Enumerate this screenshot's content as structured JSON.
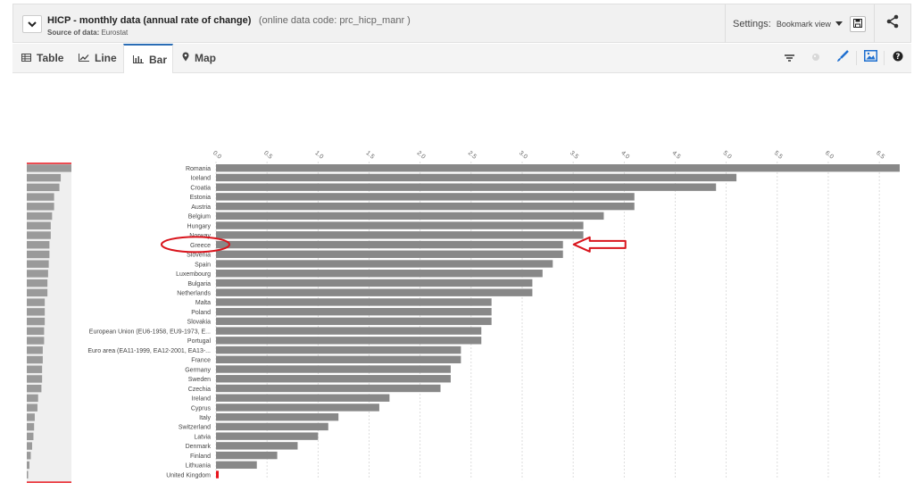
{
  "header": {
    "title": "HICP - monthly data (annual rate of change)",
    "code": "(online data code: prc_hicp_manr )",
    "source_label": "Source of data:",
    "source_value": "Eurostat",
    "settings_label": "Settings:",
    "bookmark_label": "Bookmark view",
    "icons": {
      "collapse": "chevron-down-icon",
      "save": "save-icon",
      "share": "share-icon"
    }
  },
  "tabs": [
    {
      "label": "Table",
      "icon": "table-icon"
    },
    {
      "label": "Line",
      "icon": "line-chart-icon"
    },
    {
      "label": "Bar",
      "icon": "bar-chart-icon",
      "active": true
    },
    {
      "label": "Map",
      "icon": "map-pin-icon"
    }
  ],
  "tools": [
    "filter-icon",
    "palette-icon",
    "brush-icon",
    "image-icon",
    "help-icon"
  ],
  "colors": {
    "bar": "#888888",
    "highlight": "#e8141c",
    "annotation": "#d9141c",
    "accent": "#2a6db5"
  },
  "chart_data": {
    "type": "bar",
    "orientation": "horizontal",
    "categories": [
      "Romania",
      "Iceland",
      "Croatia",
      "Estonia",
      "Austria",
      "Belgium",
      "Hungary",
      "Norway",
      "Greece",
      "Slovenia",
      "Spain",
      "Luxembourg",
      "Bulgaria",
      "Netherlands",
      "Malta",
      "Poland",
      "Slovakia",
      "European Union (EU6-1958, EU9-1973, E...",
      "Portugal",
      "Euro area (EA11-1999, EA12-2001, EA13-...",
      "France",
      "Germany",
      "Sweden",
      "Czechia",
      "Ireland",
      "Cyprus",
      "Italy",
      "Switzerland",
      "Latvia",
      "Denmark",
      "Finland",
      "Lithuania",
      "United Kingdom"
    ],
    "values": [
      6.7,
      5.1,
      4.9,
      4.1,
      4.1,
      3.8,
      3.6,
      3.6,
      3.4,
      3.4,
      3.3,
      3.2,
      3.1,
      3.1,
      2.7,
      2.7,
      2.7,
      2.6,
      2.6,
      2.4,
      2.4,
      2.3,
      2.3,
      2.2,
      1.7,
      1.6,
      1.2,
      1.1,
      1.0,
      0.8,
      0.6,
      0.4,
      0.0
    ],
    "ticks": [
      "0.0",
      "0.5",
      "1.0",
      "1.5",
      "2.0",
      "2.5",
      "3.0",
      "3.5",
      "4.0",
      "4.5",
      "5.0",
      "5.5",
      "6.0",
      "6.5"
    ],
    "xlim": [
      0,
      6.7
    ],
    "highlighted_category": "United Kingdom",
    "annotated_category": "Greece",
    "grid": true
  }
}
